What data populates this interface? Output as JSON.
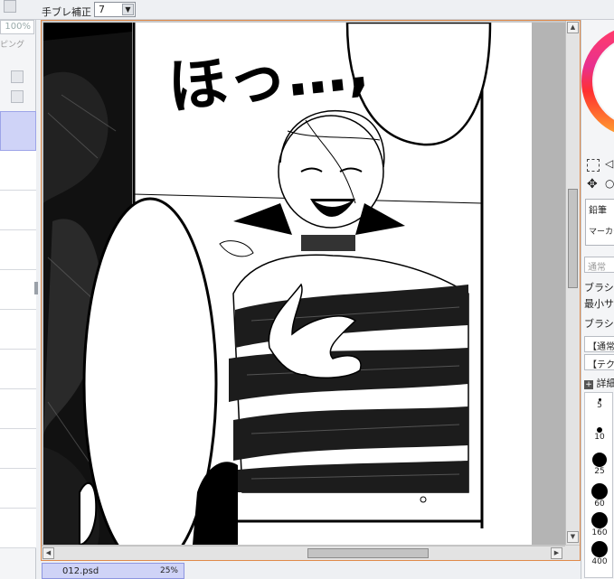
{
  "toolbar": {
    "stabilizer_label": "手ブレ補正",
    "stabilizer_value": "7"
  },
  "left_panel": {
    "zoom_percent": "100%",
    "partial_label": "ピング"
  },
  "file_tab": {
    "name": "012.psd",
    "zoom": "25%"
  },
  "right_panel": {
    "tool_pencil": "鉛筆",
    "tool_marker": "マーカー",
    "blend_mode": "通常",
    "brush_size_label": "ブラシサ",
    "min_size_label": "最小サ",
    "brush_density_label": "ブラシ濃",
    "option_normal": "【通常",
    "option_texture": "【テクス",
    "detail_label": "詳細",
    "brush_sizes": [
      "5",
      "10",
      "25",
      "60",
      "160",
      "400"
    ]
  },
  "artwork": {
    "sfx_text": "ほっ…,"
  },
  "colors": {
    "accent_border": "#e08a4a",
    "selection": "#cfd3f7"
  }
}
